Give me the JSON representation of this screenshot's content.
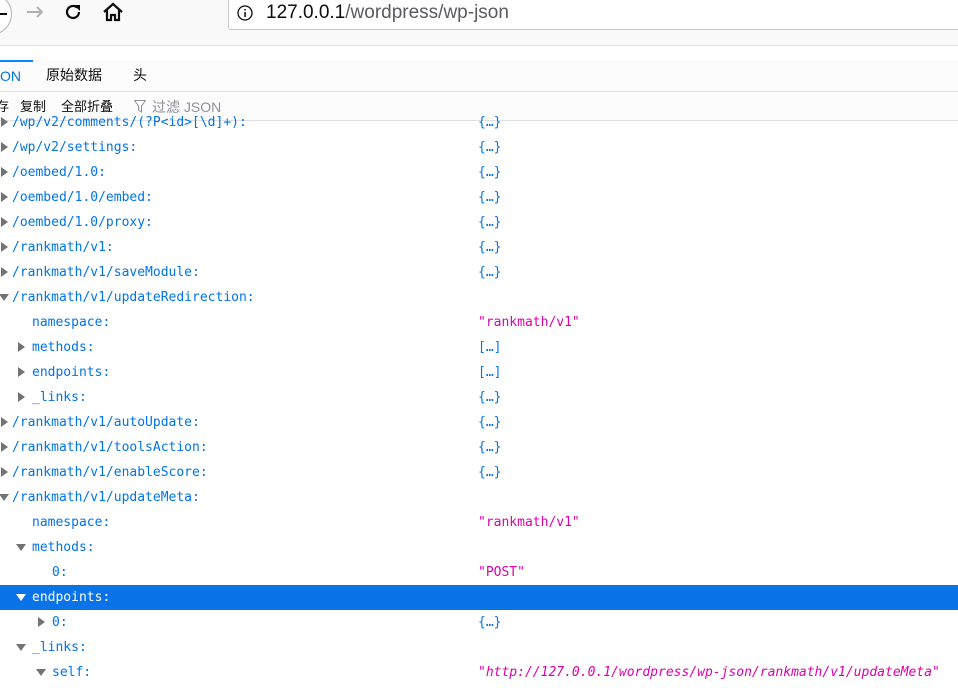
{
  "browser": {
    "url_host": "127.0.0.1",
    "url_path": "/wordpress/wp-json"
  },
  "tabs": [
    {
      "label": "ON",
      "active": true
    },
    {
      "label": "原始数据",
      "active": false
    },
    {
      "label": "头",
      "active": false
    }
  ],
  "subtoolbar": {
    "save_label": "存",
    "copy_label": "复制",
    "collapse_all_label": "全部折叠",
    "filter_placeholder": "过滤 JSON"
  },
  "tree": [
    {
      "key": "/wp/v2/comments/(?P<id>[\\d]+):",
      "value": "{…}",
      "type": "obj",
      "level": 0,
      "state": "collapsed"
    },
    {
      "key": "/wp/v2/settings:",
      "value": "{…}",
      "type": "obj",
      "level": 0,
      "state": "collapsed"
    },
    {
      "key": "/oembed/1.0:",
      "value": "{…}",
      "type": "obj",
      "level": 0,
      "state": "collapsed"
    },
    {
      "key": "/oembed/1.0/embed:",
      "value": "{…}",
      "type": "obj",
      "level": 0,
      "state": "collapsed"
    },
    {
      "key": "/oembed/1.0/proxy:",
      "value": "{…}",
      "type": "obj",
      "level": 0,
      "state": "collapsed"
    },
    {
      "key": "/rankmath/v1:",
      "value": "{…}",
      "type": "obj",
      "level": 0,
      "state": "collapsed"
    },
    {
      "key": "/rankmath/v1/saveModule:",
      "value": "{…}",
      "type": "obj",
      "level": 0,
      "state": "collapsed"
    },
    {
      "key": "/rankmath/v1/updateRedirection:",
      "value": "",
      "type": "obj",
      "level": 0,
      "state": "expanded"
    },
    {
      "key": "namespace:",
      "value": "\"rankmath/v1\"",
      "type": "str",
      "level": 1,
      "state": "leaf"
    },
    {
      "key": "methods:",
      "value": "[…]",
      "type": "obj",
      "level": 1,
      "state": "collapsed"
    },
    {
      "key": "endpoints:",
      "value": "[…]",
      "type": "obj",
      "level": 1,
      "state": "collapsed"
    },
    {
      "key": "_links:",
      "value": "{…}",
      "type": "obj",
      "level": 1,
      "state": "collapsed"
    },
    {
      "key": "/rankmath/v1/autoUpdate:",
      "value": "{…}",
      "type": "obj",
      "level": 0,
      "state": "collapsed"
    },
    {
      "key": "/rankmath/v1/toolsAction:",
      "value": "{…}",
      "type": "obj",
      "level": 0,
      "state": "collapsed"
    },
    {
      "key": "/rankmath/v1/enableScore:",
      "value": "{…}",
      "type": "obj",
      "level": 0,
      "state": "collapsed"
    },
    {
      "key": "/rankmath/v1/updateMeta:",
      "value": "",
      "type": "obj",
      "level": 0,
      "state": "expanded"
    },
    {
      "key": "namespace:",
      "value": "\"rankmath/v1\"",
      "type": "str",
      "level": 1,
      "state": "leaf"
    },
    {
      "key": "methods:",
      "value": "",
      "type": "obj",
      "level": 1,
      "state": "expanded"
    },
    {
      "key": "0:",
      "value": "\"POST\"",
      "type": "str",
      "level": 2,
      "state": "leaf"
    },
    {
      "key": "endpoints:",
      "value": "",
      "type": "obj",
      "level": 1,
      "state": "expanded",
      "selected": true
    },
    {
      "key": "0:",
      "value": "{…}",
      "type": "obj",
      "level": 2,
      "state": "collapsed"
    },
    {
      "key": "_links:",
      "value": "",
      "type": "obj",
      "level": 1,
      "state": "expanded"
    },
    {
      "key": "self:",
      "value": "\"http://127.0.0.1/wordpress/wp-json/rankmath/v1/updateMeta\"",
      "type": "link",
      "level": 2,
      "state": "expanded"
    }
  ],
  "colors": {
    "key": "#0074e8",
    "string": "#dd00a9",
    "selection": "#0a73e8",
    "tab_accent": "#0a84ff"
  }
}
